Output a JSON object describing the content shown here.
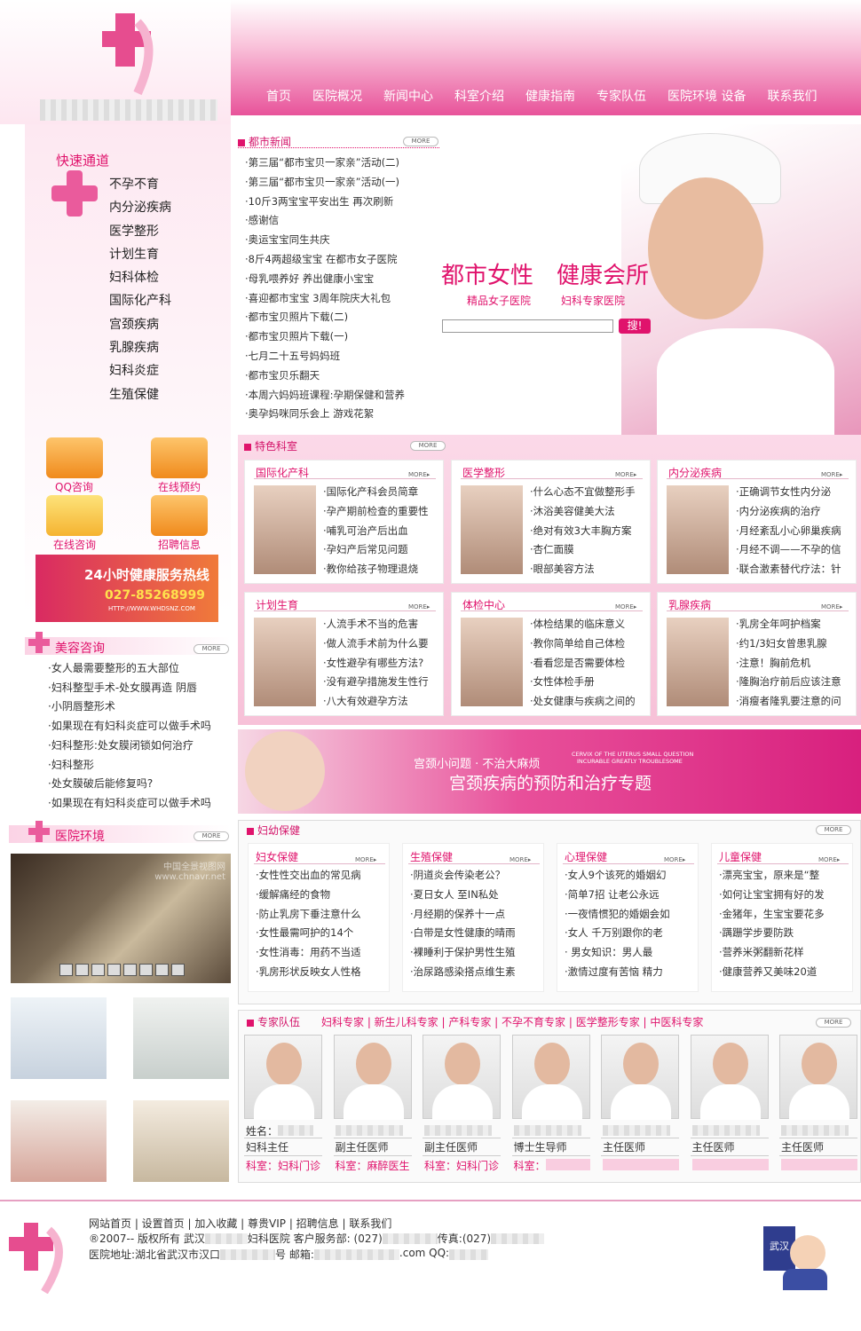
{
  "header": {
    "nav": [
      "首页",
      "医院概况",
      "新闻中心",
      "科室介绍",
      "健康指南",
      "专家队伍",
      "医院环境 设备",
      "联系我们"
    ]
  },
  "quick": {
    "title": "快速通道",
    "items": [
      "不孕不育",
      "内分泌疾病",
      "医学整形",
      "计划生育",
      "妇科体检",
      "国际化产科",
      "宫颈疾病",
      "乳腺疾病",
      "妇科炎症",
      "生殖保健"
    ]
  },
  "consult": [
    "QQ咨询",
    "在线预约",
    "在线咨询",
    "招聘信息"
  ],
  "hotline": {
    "title": "24小时健康服务热线",
    "phone": "027-85268999",
    "url": "HTTP://WWW.WHDSNZ.COM"
  },
  "beauty": {
    "title": "美容咨询",
    "more": "MORE",
    "items": [
      "·女人最需要整形的五大部位",
      "·妇科整型手术-处女膜再造 阴唇",
      "·小阴唇整形术",
      "·如果现在有妇科炎症可以做手术吗",
      "·妇科整形:处女膜闭锁如何治疗",
      "·妇科整形",
      "·处女膜破后能修复吗?",
      "·如果现在有妇科炎症可以做手术吗"
    ]
  },
  "env": {
    "title": "医院环境",
    "more": "MORE",
    "watermark": "中国全景视图网 www.chnavr.net"
  },
  "news": {
    "title": "都市新闻",
    "more": "MORE",
    "items": [
      "·第三届“都市宝贝一家亲”活动(二)",
      "·第三届“都市宝贝一家亲”活动(一)",
      "·10斤3两宝宝平安出生 再次刷新",
      "·感谢信",
      "·奥运宝宝同生共庆",
      "·8斤4两超级宝宝 在都市女子医院",
      "·母乳喂养好 养出健康小宝宝",
      "·喜迎都市宝宝 3周年院庆大礼包",
      "·都市宝贝照片下载(二)",
      "·都市宝贝照片下载(一)",
      "·七月二十五号妈妈班",
      "·都市宝贝乐翻天",
      "·本周六妈妈班课程:孕期保健和营养",
      "·奥孕妈咪同乐会上 游戏花絮"
    ]
  },
  "hero": {
    "slogan1": "都市女性",
    "slogan2": "健康会所",
    "sub1": "精品女子医院",
    "sub2": "妇科专家医院",
    "search_btn": "搜!"
  },
  "special": {
    "title": "特色科室",
    "more": "MORE",
    "cards": [
      {
        "title": "国际化产科",
        "items": [
          "·国际化产科会员简章",
          "·孕产期前检查的重要性",
          "·哺乳可治产后出血",
          "·孕妇产后常见问题",
          "·教你给孩子物理退烧"
        ]
      },
      {
        "title": "医学整形",
        "items": [
          "·什么心态不宜做整形手",
          "·沐浴美容健美大法",
          "·绝对有效3大丰胸方案",
          "·杏仁面膜",
          "·眼部美容方法"
        ]
      },
      {
        "title": "内分泌疾病",
        "items": [
          "·正确调节女性内分泌",
          "·内分泌疾病的治疗",
          "·月经紊乱小心卵巢疾病",
          "·月经不调——不孕的信",
          "·联合激素替代疗法：针"
        ]
      },
      {
        "title": "计划生育",
        "items": [
          "·人流手术不当的危害",
          "·做人流手术前为什么要",
          "·女性避孕有哪些方法?",
          "·没有避孕措施发生性行",
          "·八大有效避孕方法"
        ]
      },
      {
        "title": "体检中心",
        "items": [
          "·体检结果的临床意义",
          "·教你简单给自己体检",
          "·看看您是否需要体检",
          "·女性体检手册",
          "·处女健康与疾病之间的"
        ]
      },
      {
        "title": "乳腺疾病",
        "items": [
          "·乳房全年呵护档案",
          "·约1/3妇女曾患乳腺",
          "·注意！胸前危机",
          "·隆胸治疗前后应该注意",
          "·消瘦者隆乳要注意的问"
        ]
      }
    ]
  },
  "banner": {
    "line1": "宫颈小问题 · 不治大麻烦",
    "en1": "CERVIX OF THE UTERUS SMALL QUESTION",
    "en2": "INCURABLE GREATLY TROUBLESOME",
    "line2": "宫颈疾病的预防和治疗专题"
  },
  "care": {
    "title": "妇幼保健",
    "more": "MORE",
    "cols": [
      {
        "title": "妇女保健",
        "items": [
          "·女性性交出血的常见病",
          "·缓解痛经的食物",
          "·防止乳房下垂注意什么",
          "·女性最需呵护的14个",
          "·女性消毒：用药不当适",
          "·乳房形状反映女人性格"
        ]
      },
      {
        "title": "生殖保健",
        "items": [
          "·阴道炎会传染老公？",
          "·夏日女人 至IN私处",
          "·月经期的保养十一点",
          "·白带是女性健康的晴雨",
          "·裸睡利于保护男性生殖",
          "·治尿路感染搭点维生素"
        ]
      },
      {
        "title": "心理保健",
        "items": [
          "·女人9个该死的婚姻幻",
          "·简单7招 让老公永远",
          "·一夜情惯犯的婚姻会如",
          "·女人 千万别跟你的老",
          "· 男女知识：男人最",
          "·激情过度有苦恼 精力"
        ]
      },
      {
        "title": "儿童保健",
        "items": [
          "·漂亮宝宝，原来是“整",
          "·如何让宝宝拥有好的发",
          "·金猪年，生宝宝要花多",
          "·蹒跚学步要防跌",
          "·营养米粥翻新花样",
          "·健康营养又美味20道"
        ]
      }
    ]
  },
  "experts": {
    "title": "专家队伍",
    "tabs": "妇科专家 | 新生儿科专家 | 产科专家 | 不孕不育专家 | 医学整形专家 | 中医科专家",
    "more": "MORE",
    "name_label": "姓名：",
    "cards": [
      {
        "title": "妇科主任",
        "dept": "科室：妇科门诊"
      },
      {
        "title": "副主任医师",
        "dept": "科室：麻醉医生"
      },
      {
        "title": "副主任医师",
        "dept": "科室：妇科门诊"
      },
      {
        "title": "博士生导师",
        "dept": "科室："
      },
      {
        "title": "主任医师",
        "dept": ""
      },
      {
        "title": "主任医师",
        "dept": ""
      },
      {
        "title": "主任医师",
        "dept": ""
      }
    ]
  },
  "footer": {
    "links": "网站首页 | 设置首页 | 加入收藏 | 尊贵VIP | 招聘信息 | 联系我们",
    "line2a": "®2007-- 版权所有 武汉",
    "line2b": "妇科医院 客户服务部: (027)",
    "line2c": "传真:(027)",
    "line3a": "医院地址:湖北省武汉市汉口",
    "line3b": "号 邮箱:",
    "line3c": ".com QQ:",
    "police": "武汉"
  },
  "colors": {
    "accent": "#e0136c",
    "pink_light": "#fbe3ef"
  }
}
